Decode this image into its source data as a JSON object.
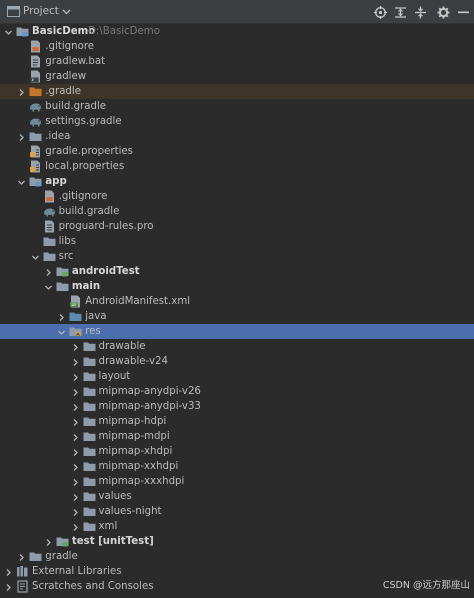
{
  "header": {
    "title": "Project"
  },
  "tree": [
    {
      "label": "BasicDemo",
      "hint": "D:\\BasicDemo",
      "icon": "folder-module-icon",
      "arrow": "down",
      "depth": 0,
      "bold": true
    },
    {
      "label": ".gitignore",
      "icon": "gitignore-file-icon",
      "arrow": "none",
      "depth": 1
    },
    {
      "label": "gradlew.bat",
      "icon": "bat-file-icon",
      "arrow": "none",
      "depth": 1
    },
    {
      "label": "gradlew",
      "icon": "shell-file-icon",
      "arrow": "none",
      "depth": 1
    },
    {
      "label": ".gradle",
      "icon": "folder-orange-icon",
      "arrow": "right",
      "depth": 1,
      "highlight": true
    },
    {
      "label": "build.gradle",
      "icon": "gradle-elephant-icon",
      "arrow": "none",
      "depth": 1
    },
    {
      "label": "settings.gradle",
      "icon": "gradle-elephant-icon",
      "arrow": "none",
      "depth": 1
    },
    {
      "label": ".idea",
      "icon": "folder-icon",
      "arrow": "right",
      "depth": 1
    },
    {
      "label": "gradle.properties",
      "icon": "properties-file-icon",
      "arrow": "none",
      "depth": 1
    },
    {
      "label": "local.properties",
      "icon": "properties-file-icon",
      "arrow": "none",
      "depth": 1
    },
    {
      "label": "app",
      "icon": "folder-module-icon",
      "arrow": "down",
      "depth": 1,
      "bold": true
    },
    {
      "label": ".gitignore",
      "icon": "gitignore-file-icon",
      "arrow": "none",
      "depth": 2
    },
    {
      "label": "build.gradle",
      "icon": "gradle-elephant-icon",
      "arrow": "none",
      "depth": 2
    },
    {
      "label": "proguard-rules.pro",
      "icon": "text-file-icon",
      "arrow": "none",
      "depth": 2
    },
    {
      "label": "libs",
      "icon": "folder-icon",
      "arrow": "none",
      "depth": 2
    },
    {
      "label": "src",
      "icon": "folder-icon",
      "arrow": "down",
      "depth": 2
    },
    {
      "label": "androidTest",
      "icon": "folder-test-icon",
      "arrow": "right",
      "depth": 3,
      "bold": true
    },
    {
      "label": "main",
      "icon": "folder-icon",
      "arrow": "down",
      "depth": 3,
      "bold": true
    },
    {
      "label": "AndroidManifest.xml",
      "icon": "manifest-file-icon",
      "arrow": "none",
      "depth": 4
    },
    {
      "label": "java",
      "icon": "folder-source-icon",
      "arrow": "right",
      "depth": 4
    },
    {
      "label": "res",
      "icon": "folder-res-icon",
      "arrow": "down",
      "depth": 4,
      "selected": true
    },
    {
      "label": "drawable",
      "icon": "folder-icon",
      "arrow": "right",
      "depth": 5
    },
    {
      "label": "drawable-v24",
      "icon": "folder-icon",
      "arrow": "right",
      "depth": 5
    },
    {
      "label": "layout",
      "icon": "folder-icon",
      "arrow": "right",
      "depth": 5
    },
    {
      "label": "mipmap-anydpi-v26",
      "icon": "folder-icon",
      "arrow": "right",
      "depth": 5
    },
    {
      "label": "mipmap-anydpi-v33",
      "icon": "folder-icon",
      "arrow": "right",
      "depth": 5
    },
    {
      "label": "mipmap-hdpi",
      "icon": "folder-icon",
      "arrow": "right",
      "depth": 5
    },
    {
      "label": "mipmap-mdpi",
      "icon": "folder-icon",
      "arrow": "right",
      "depth": 5
    },
    {
      "label": "mipmap-xhdpi",
      "icon": "folder-icon",
      "arrow": "right",
      "depth": 5
    },
    {
      "label": "mipmap-xxhdpi",
      "icon": "folder-icon",
      "arrow": "right",
      "depth": 5
    },
    {
      "label": "mipmap-xxxhdpi",
      "icon": "folder-icon",
      "arrow": "right",
      "depth": 5
    },
    {
      "label": "values",
      "icon": "folder-icon",
      "arrow": "right",
      "depth": 5
    },
    {
      "label": "values-night",
      "icon": "folder-icon",
      "arrow": "right",
      "depth": 5
    },
    {
      "label": "xml",
      "icon": "folder-icon",
      "arrow": "right",
      "depth": 5
    },
    {
      "label": "test [unitTest]",
      "icon": "folder-test-icon",
      "arrow": "right",
      "depth": 3,
      "bold": true
    },
    {
      "label": "gradle",
      "icon": "folder-icon",
      "arrow": "right",
      "depth": 1
    },
    {
      "label": "External Libraries",
      "icon": "libraries-icon",
      "arrow": "right",
      "depth": 0
    },
    {
      "label": "Scratches and Consoles",
      "icon": "scratches-icon",
      "arrow": "right",
      "depth": 0
    }
  ],
  "watermark": "CSDN @远方那座山",
  "colors": {
    "background": "#2b2b2b",
    "header": "#3c3f41",
    "selected": "#4b6eaf",
    "highlight": "#3d3529",
    "folder": "#8f9ba8",
    "folder_orange": "#c57726",
    "folder_source": "#5b89b0",
    "folder_test": "#5b8a57",
    "gradle": "#6e8a96"
  }
}
